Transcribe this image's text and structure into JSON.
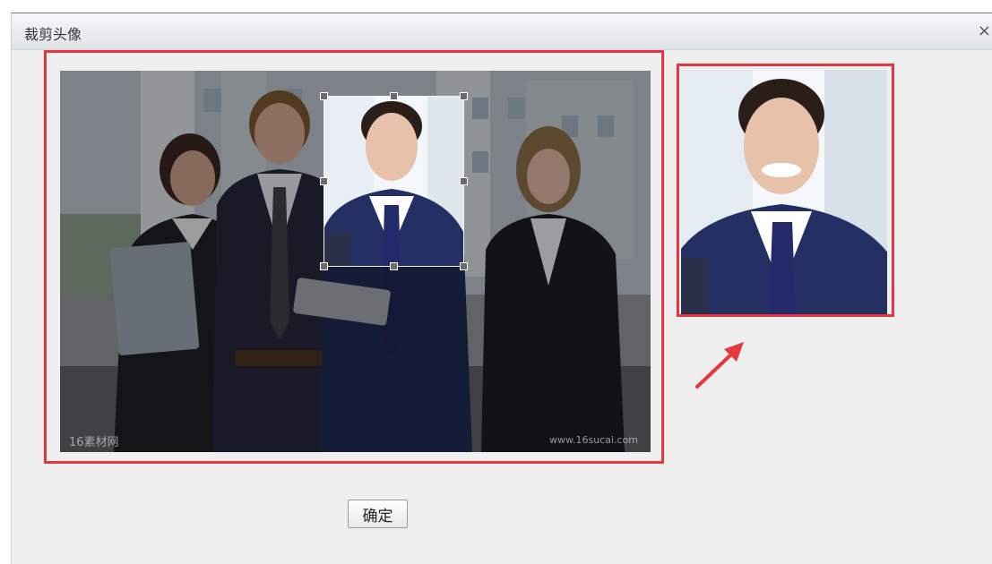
{
  "dialog": {
    "title": "裁剪头像",
    "close_glyph": "×",
    "confirm_label": "确定"
  },
  "watermarks": {
    "left": "16素材网",
    "right": "www.16sucai.com"
  },
  "colors": {
    "highlight": "#e5373d",
    "arrow": "#e5373d"
  },
  "icons": {
    "close": "close-icon",
    "arrow": "arrow-up-right-icon"
  }
}
